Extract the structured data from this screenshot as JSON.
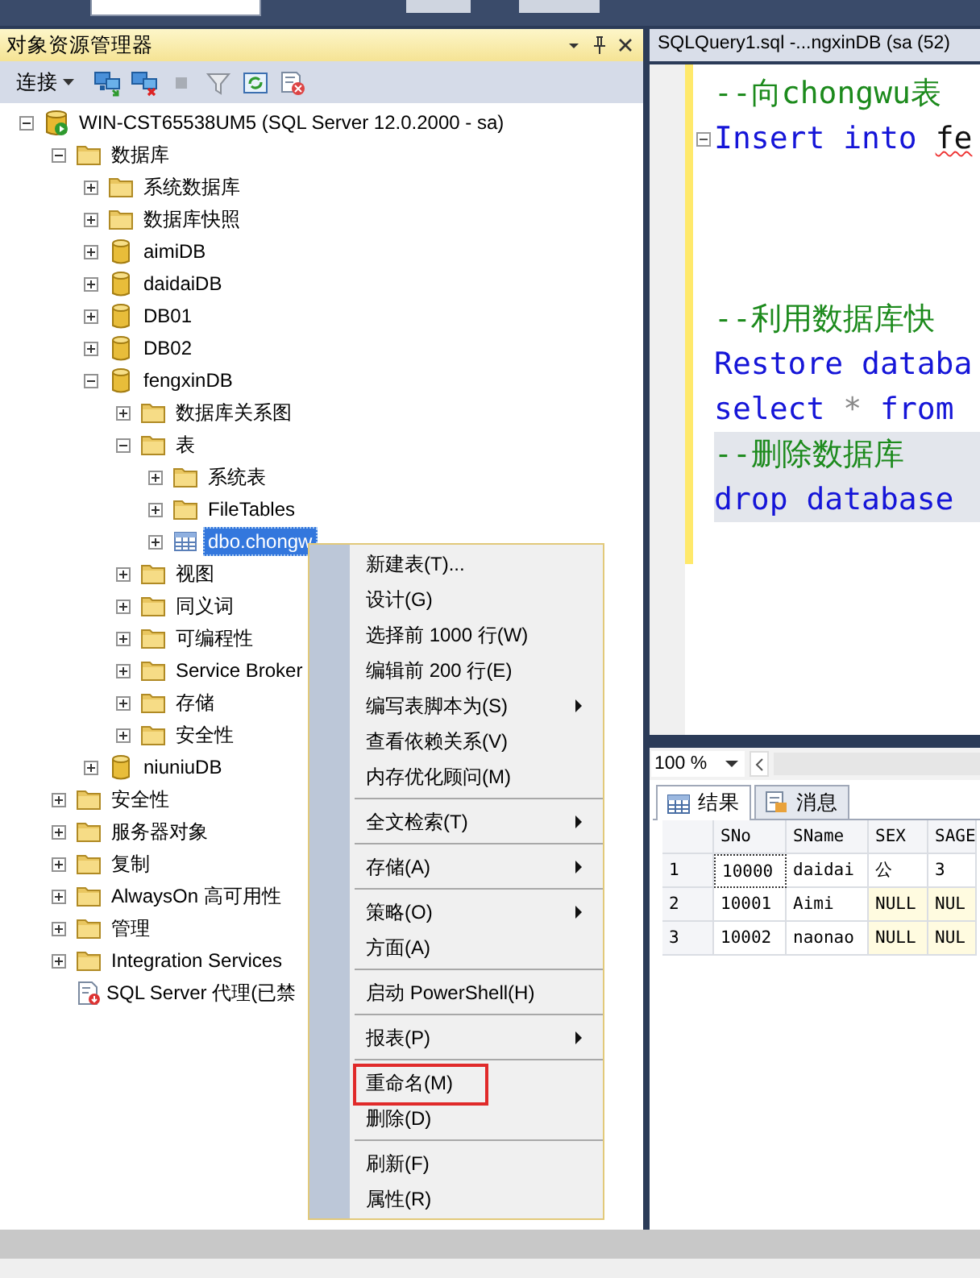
{
  "explorer": {
    "title": "对象资源管理器",
    "toolbar": {
      "connect": "连接"
    },
    "tree": [
      {
        "label": "WIN-CST65538UM5 (SQL Server 12.0.2000 - sa)",
        "kind": "server",
        "expanded": true,
        "selected": false,
        "children": [
          {
            "label": "数据库",
            "kind": "folder",
            "expanded": true,
            "selected": false,
            "children": [
              {
                "label": "系统数据库",
                "kind": "folder",
                "expanded": false,
                "selected": false
              },
              {
                "label": "数据库快照",
                "kind": "folder",
                "expanded": false,
                "selected": false
              },
              {
                "label": "aimiDB",
                "kind": "database",
                "expanded": false,
                "selected": false
              },
              {
                "label": "daidaiDB",
                "kind": "database",
                "expanded": false,
                "selected": false
              },
              {
                "label": "DB01",
                "kind": "database",
                "expanded": false,
                "selected": false
              },
              {
                "label": "DB02",
                "kind": "database",
                "expanded": false,
                "selected": false
              },
              {
                "label": "fengxinDB",
                "kind": "database",
                "expanded": true,
                "selected": false,
                "children": [
                  {
                    "label": "数据库关系图",
                    "kind": "folder",
                    "expanded": false,
                    "selected": false
                  },
                  {
                    "label": "表",
                    "kind": "folder",
                    "expanded": true,
                    "selected": false,
                    "children": [
                      {
                        "label": "系统表",
                        "kind": "folder",
                        "expanded": false,
                        "selected": false
                      },
                      {
                        "label": "FileTables",
                        "kind": "folder",
                        "expanded": false,
                        "selected": false
                      },
                      {
                        "label": "dbo.chongw",
                        "kind": "table",
                        "expanded": false,
                        "selected": true
                      }
                    ]
                  },
                  {
                    "label": "视图",
                    "kind": "folder",
                    "expanded": false,
                    "selected": false
                  },
                  {
                    "label": "同义词",
                    "kind": "folder",
                    "expanded": false,
                    "selected": false
                  },
                  {
                    "label": "可编程性",
                    "kind": "folder",
                    "expanded": false,
                    "selected": false
                  },
                  {
                    "label": "Service Broker",
                    "kind": "folder",
                    "expanded": false,
                    "selected": false
                  },
                  {
                    "label": "存储",
                    "kind": "folder",
                    "expanded": false,
                    "selected": false
                  },
                  {
                    "label": "安全性",
                    "kind": "folder",
                    "expanded": false,
                    "selected": false
                  }
                ]
              },
              {
                "label": "niuniuDB",
                "kind": "database",
                "expanded": false,
                "selected": false
              }
            ]
          },
          {
            "label": "安全性",
            "kind": "folder",
            "expanded": false,
            "selected": false
          },
          {
            "label": "服务器对象",
            "kind": "folder",
            "expanded": false,
            "selected": false
          },
          {
            "label": "复制",
            "kind": "folder",
            "expanded": false,
            "selected": false
          },
          {
            "label": "AlwaysOn 高可用性",
            "kind": "folder",
            "expanded": false,
            "selected": false
          },
          {
            "label": "管理",
            "kind": "folder",
            "expanded": false,
            "selected": false
          },
          {
            "label": "Integration Services",
            "kind": "folder",
            "expanded": false,
            "selected": false
          },
          {
            "label": "SQL Server 代理(已禁",
            "kind": "agent",
            "selected": false
          }
        ]
      }
    ]
  },
  "context_menu": {
    "groups": [
      [
        {
          "label": "新建表(T)...",
          "submenu": false,
          "highlighted": false
        },
        {
          "label": "设计(G)",
          "submenu": false,
          "highlighted": false
        },
        {
          "label": "选择前 1000 行(W)",
          "submenu": false,
          "highlighted": false
        },
        {
          "label": "编辑前 200 行(E)",
          "submenu": false,
          "highlighted": false
        },
        {
          "label": "编写表脚本为(S)",
          "submenu": true,
          "highlighted": false
        },
        {
          "label": "查看依赖关系(V)",
          "submenu": false,
          "highlighted": false
        },
        {
          "label": "内存优化顾问(M)",
          "submenu": false,
          "highlighted": false
        }
      ],
      [
        {
          "label": "全文检索(T)",
          "submenu": true,
          "highlighted": false
        }
      ],
      [
        {
          "label": "存储(A)",
          "submenu": true,
          "highlighted": false
        }
      ],
      [
        {
          "label": "策略(O)",
          "submenu": true,
          "highlighted": false
        },
        {
          "label": "方面(A)",
          "submenu": false,
          "highlighted": false
        }
      ],
      [
        {
          "label": "启动 PowerShell(H)",
          "submenu": false,
          "highlighted": false
        }
      ],
      [
        {
          "label": "报表(P)",
          "submenu": true,
          "highlighted": false
        }
      ],
      [
        {
          "label": "重命名(M)",
          "submenu": false,
          "highlighted": true
        },
        {
          "label": "删除(D)",
          "submenu": false,
          "highlighted": false
        }
      ],
      [
        {
          "label": "刷新(F)",
          "submenu": false,
          "highlighted": false
        },
        {
          "label": "属性(R)",
          "submenu": false,
          "highlighted": false
        }
      ]
    ]
  },
  "editor": {
    "tab": "SQLQuery1.sql -...ngxinDB (sa (52)",
    "lines": [
      {
        "kind": "code",
        "fold": false,
        "selected": false,
        "tokens": [
          {
            "text": "--向chongwu表",
            "kind": "comment"
          }
        ]
      },
      {
        "kind": "code",
        "fold": true,
        "selected": false,
        "tokens": [
          {
            "text": "Insert",
            "kind": "keyword"
          },
          {
            "text": "into",
            "kind": "keyword"
          },
          {
            "text": "fe",
            "kind": "error"
          }
        ]
      },
      {
        "kind": "blank"
      },
      {
        "kind": "blank"
      },
      {
        "kind": "blank"
      },
      {
        "kind": "code",
        "fold": false,
        "selected": false,
        "tokens": [
          {
            "text": "--利用数据库快",
            "kind": "comment"
          }
        ]
      },
      {
        "kind": "code",
        "fold": false,
        "selected": false,
        "tokens": [
          {
            "text": "Restore",
            "kind": "keyword"
          },
          {
            "text": "databa",
            "kind": "keyword"
          }
        ]
      },
      {
        "kind": "code",
        "fold": false,
        "selected": false,
        "tokens": [
          {
            "text": "select",
            "kind": "keyword"
          },
          {
            "text": "*",
            "kind": "operator"
          },
          {
            "text": "from",
            "kind": "keyword"
          }
        ]
      },
      {
        "kind": "code",
        "fold": false,
        "selected": true,
        "tokens": [
          {
            "text": "--删除数据库",
            "kind": "comment"
          }
        ]
      },
      {
        "kind": "code",
        "fold": false,
        "selected": true,
        "tokens": [
          {
            "text": "drop",
            "kind": "keyword"
          },
          {
            "text": "database",
            "kind": "keyword"
          }
        ]
      }
    ]
  },
  "results": {
    "zoom": "100 %",
    "tabs": [
      {
        "label": "结果",
        "kind": "grid",
        "selected": true
      },
      {
        "label": "消息",
        "kind": "message",
        "selected": false
      }
    ],
    "columns": [
      "SNo",
      "SName",
      "SEX",
      "SAGE"
    ],
    "rows": [
      {
        "number": "1",
        "cells": [
          {
            "text": "10000",
            "kind": "value",
            "focused": true
          },
          {
            "text": "daidai",
            "kind": "value",
            "focused": false
          },
          {
            "text": "公",
            "kind": "value",
            "focused": false
          },
          {
            "text": "3",
            "kind": "value",
            "focused": false
          }
        ]
      },
      {
        "number": "2",
        "cells": [
          {
            "text": "10001",
            "kind": "value",
            "focused": false
          },
          {
            "text": "Aimi",
            "kind": "value",
            "focused": false
          },
          {
            "text": "NULL",
            "kind": "null",
            "focused": false
          },
          {
            "text": "NUL",
            "kind": "null",
            "focused": false
          }
        ]
      },
      {
        "number": "3",
        "cells": [
          {
            "text": "10002",
            "kind": "value",
            "focused": false
          },
          {
            "text": "naonao",
            "kind": "value",
            "focused": false
          },
          {
            "text": "NULL",
            "kind": "null",
            "focused": false
          },
          {
            "text": "NUL",
            "kind": "null",
            "focused": false
          }
        ]
      }
    ]
  }
}
